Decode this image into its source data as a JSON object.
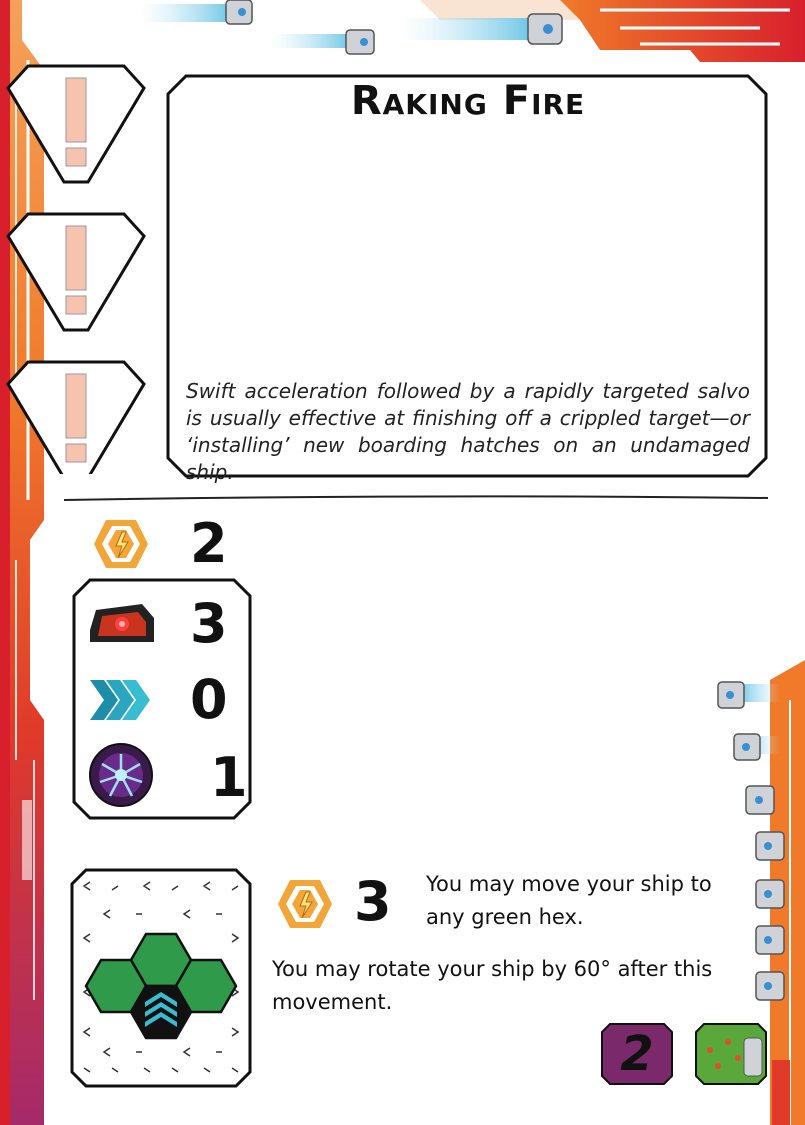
{
  "card": {
    "title": "Raking Fire",
    "flavor": "Swift acceleration followed by a rapidly targeted salvo is usually effective at finishing off a crippled target—or ‘installing’ new boarding hatches on an undamaged ship."
  },
  "stats": {
    "cost": {
      "icon": "energy-icon",
      "value": "2"
    },
    "damage": {
      "icon": "weapon-icon",
      "value": "3"
    },
    "speed": {
      "icon": "chevrons-icon",
      "value": "0"
    },
    "boarding": {
      "icon": "boarding-icon",
      "value": "1"
    }
  },
  "ability": {
    "icon": "energy-icon",
    "cost": "3",
    "text1": "You may move your ship to any green hex.",
    "text2": "You may rotate your ship by 60° after this movement."
  },
  "badges": {
    "level": "2"
  },
  "colors": {
    "accent_red": "#d8202c",
    "accent_orange": "#f07a2a",
    "hex_green": "#2e9a4a",
    "energy_orange": "#f2a63a"
  }
}
